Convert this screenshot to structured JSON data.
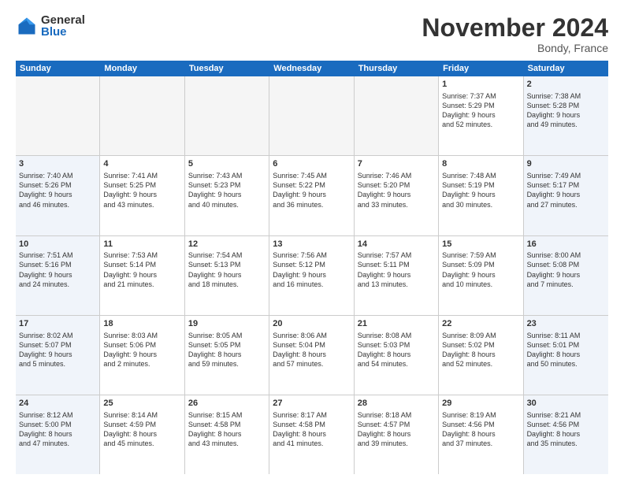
{
  "logo": {
    "general": "General",
    "blue": "Blue"
  },
  "header": {
    "month": "November 2024",
    "location": "Bondy, France"
  },
  "weekdays": [
    "Sunday",
    "Monday",
    "Tuesday",
    "Wednesday",
    "Thursday",
    "Friday",
    "Saturday"
  ],
  "weeks": [
    [
      {
        "day": "",
        "info": ""
      },
      {
        "day": "",
        "info": ""
      },
      {
        "day": "",
        "info": ""
      },
      {
        "day": "",
        "info": ""
      },
      {
        "day": "",
        "info": ""
      },
      {
        "day": "1",
        "info": "Sunrise: 7:37 AM\nSunset: 5:29 PM\nDaylight: 9 hours\nand 52 minutes."
      },
      {
        "day": "2",
        "info": "Sunrise: 7:38 AM\nSunset: 5:28 PM\nDaylight: 9 hours\nand 49 minutes."
      }
    ],
    [
      {
        "day": "3",
        "info": "Sunrise: 7:40 AM\nSunset: 5:26 PM\nDaylight: 9 hours\nand 46 minutes."
      },
      {
        "day": "4",
        "info": "Sunrise: 7:41 AM\nSunset: 5:25 PM\nDaylight: 9 hours\nand 43 minutes."
      },
      {
        "day": "5",
        "info": "Sunrise: 7:43 AM\nSunset: 5:23 PM\nDaylight: 9 hours\nand 40 minutes."
      },
      {
        "day": "6",
        "info": "Sunrise: 7:45 AM\nSunset: 5:22 PM\nDaylight: 9 hours\nand 36 minutes."
      },
      {
        "day": "7",
        "info": "Sunrise: 7:46 AM\nSunset: 5:20 PM\nDaylight: 9 hours\nand 33 minutes."
      },
      {
        "day": "8",
        "info": "Sunrise: 7:48 AM\nSunset: 5:19 PM\nDaylight: 9 hours\nand 30 minutes."
      },
      {
        "day": "9",
        "info": "Sunrise: 7:49 AM\nSunset: 5:17 PM\nDaylight: 9 hours\nand 27 minutes."
      }
    ],
    [
      {
        "day": "10",
        "info": "Sunrise: 7:51 AM\nSunset: 5:16 PM\nDaylight: 9 hours\nand 24 minutes."
      },
      {
        "day": "11",
        "info": "Sunrise: 7:53 AM\nSunset: 5:14 PM\nDaylight: 9 hours\nand 21 minutes."
      },
      {
        "day": "12",
        "info": "Sunrise: 7:54 AM\nSunset: 5:13 PM\nDaylight: 9 hours\nand 18 minutes."
      },
      {
        "day": "13",
        "info": "Sunrise: 7:56 AM\nSunset: 5:12 PM\nDaylight: 9 hours\nand 16 minutes."
      },
      {
        "day": "14",
        "info": "Sunrise: 7:57 AM\nSunset: 5:11 PM\nDaylight: 9 hours\nand 13 minutes."
      },
      {
        "day": "15",
        "info": "Sunrise: 7:59 AM\nSunset: 5:09 PM\nDaylight: 9 hours\nand 10 minutes."
      },
      {
        "day": "16",
        "info": "Sunrise: 8:00 AM\nSunset: 5:08 PM\nDaylight: 9 hours\nand 7 minutes."
      }
    ],
    [
      {
        "day": "17",
        "info": "Sunrise: 8:02 AM\nSunset: 5:07 PM\nDaylight: 9 hours\nand 5 minutes."
      },
      {
        "day": "18",
        "info": "Sunrise: 8:03 AM\nSunset: 5:06 PM\nDaylight: 9 hours\nand 2 minutes."
      },
      {
        "day": "19",
        "info": "Sunrise: 8:05 AM\nSunset: 5:05 PM\nDaylight: 8 hours\nand 59 minutes."
      },
      {
        "day": "20",
        "info": "Sunrise: 8:06 AM\nSunset: 5:04 PM\nDaylight: 8 hours\nand 57 minutes."
      },
      {
        "day": "21",
        "info": "Sunrise: 8:08 AM\nSunset: 5:03 PM\nDaylight: 8 hours\nand 54 minutes."
      },
      {
        "day": "22",
        "info": "Sunrise: 8:09 AM\nSunset: 5:02 PM\nDaylight: 8 hours\nand 52 minutes."
      },
      {
        "day": "23",
        "info": "Sunrise: 8:11 AM\nSunset: 5:01 PM\nDaylight: 8 hours\nand 50 minutes."
      }
    ],
    [
      {
        "day": "24",
        "info": "Sunrise: 8:12 AM\nSunset: 5:00 PM\nDaylight: 8 hours\nand 47 minutes."
      },
      {
        "day": "25",
        "info": "Sunrise: 8:14 AM\nSunset: 4:59 PM\nDaylight: 8 hours\nand 45 minutes."
      },
      {
        "day": "26",
        "info": "Sunrise: 8:15 AM\nSunset: 4:58 PM\nDaylight: 8 hours\nand 43 minutes."
      },
      {
        "day": "27",
        "info": "Sunrise: 8:17 AM\nSunset: 4:58 PM\nDaylight: 8 hours\nand 41 minutes."
      },
      {
        "day": "28",
        "info": "Sunrise: 8:18 AM\nSunset: 4:57 PM\nDaylight: 8 hours\nand 39 minutes."
      },
      {
        "day": "29",
        "info": "Sunrise: 8:19 AM\nSunset: 4:56 PM\nDaylight: 8 hours\nand 37 minutes."
      },
      {
        "day": "30",
        "info": "Sunrise: 8:21 AM\nSunset: 4:56 PM\nDaylight: 8 hours\nand 35 minutes."
      }
    ]
  ]
}
